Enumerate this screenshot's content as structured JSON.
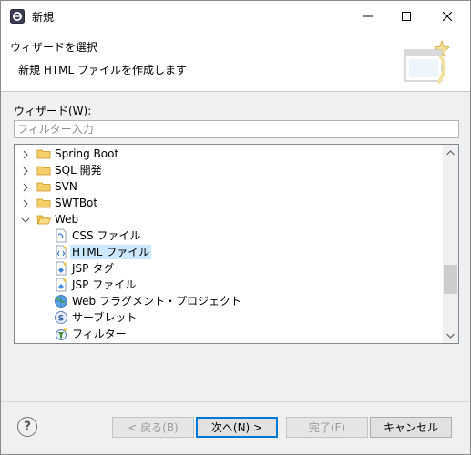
{
  "window": {
    "title": "新規"
  },
  "header": {
    "title": "ウィザードを選択",
    "description": "新規 HTML ファイルを作成します"
  },
  "wizards": {
    "label": "ウィザード(W):",
    "filter_placeholder": "フィルター入力",
    "filter_value": "",
    "tree": [
      {
        "label": "Spring Boot",
        "icon": "folder-icon",
        "level": 0,
        "expanded": false
      },
      {
        "label": "SQL 開発",
        "icon": "folder-icon",
        "level": 0,
        "expanded": false
      },
      {
        "label": "SVN",
        "icon": "folder-icon",
        "level": 0,
        "expanded": false
      },
      {
        "label": "SWTBot",
        "icon": "folder-icon",
        "level": 0,
        "expanded": false
      },
      {
        "label": "Web",
        "icon": "folder-icon",
        "level": 0,
        "expanded": true
      },
      {
        "label": "CSS ファイル",
        "icon": "css-file-icon",
        "level": 1
      },
      {
        "label": "HTML ファイル",
        "icon": "html-file-icon",
        "level": 1,
        "selected": true
      },
      {
        "label": "JSP タグ",
        "icon": "jsp-tag-icon",
        "level": 1
      },
      {
        "label": "JSP ファイル",
        "icon": "jsp-file-icon",
        "level": 1
      },
      {
        "label": "Web フラグメント・プロジェクト",
        "icon": "web-fragment-project-icon",
        "level": 1
      },
      {
        "label": "サーブレット",
        "icon": "servlet-icon",
        "level": 1
      },
      {
        "label": "フィルター",
        "icon": "filter-icon",
        "level": 1
      }
    ]
  },
  "buttons": {
    "back": "< 戻る(B)",
    "next": "次へ(N) >",
    "finish": "完了(F)",
    "cancel": "キャンセル",
    "help": "?"
  },
  "colors": {
    "selection": "#cce8ff",
    "primary_border": "#0078d7",
    "folder": "#e8b84a"
  }
}
